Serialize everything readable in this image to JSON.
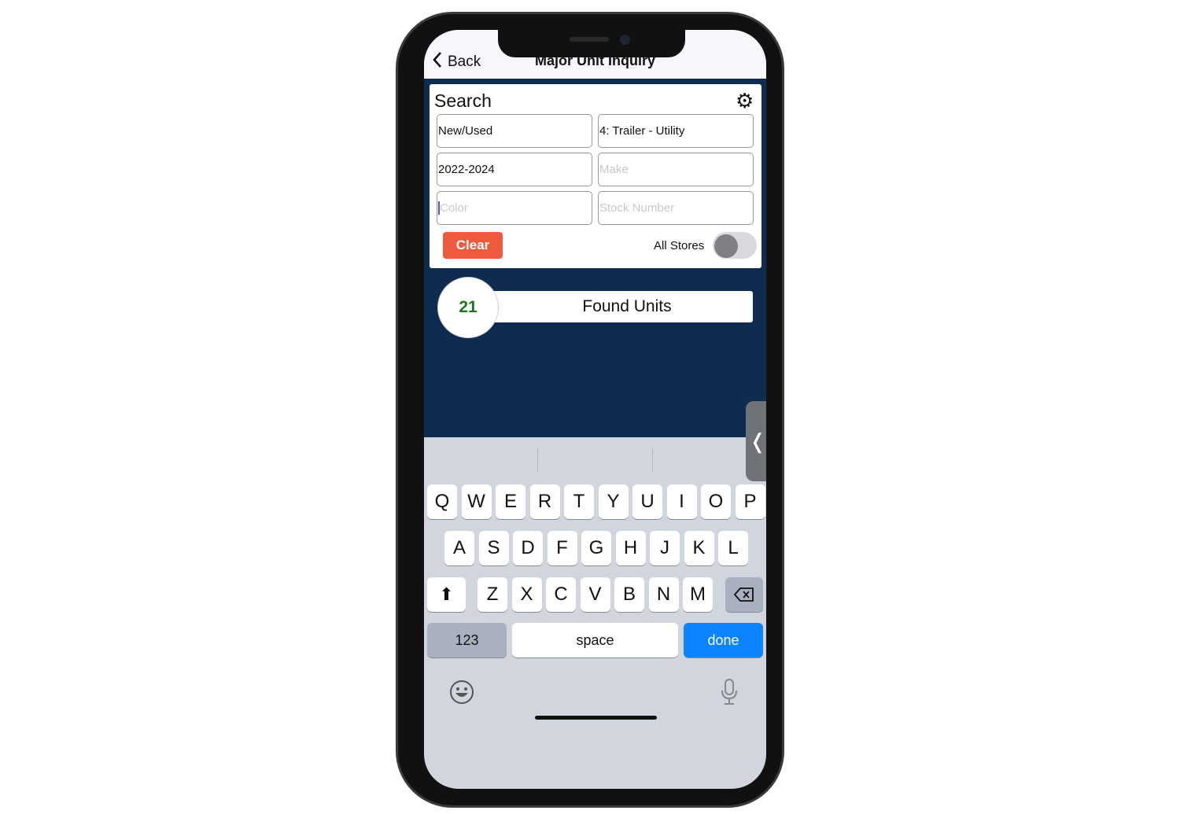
{
  "nav": {
    "back_label": "Back",
    "title": "Major Unit Inquiry"
  },
  "search": {
    "heading": "Search",
    "fields": {
      "new_used": {
        "value": "New/Used"
      },
      "category": {
        "value": "4: Trailer - Utility"
      },
      "years": {
        "value": "2022-2024"
      },
      "make": {
        "placeholder": "Make"
      },
      "color": {
        "placeholder": "Color"
      },
      "stock": {
        "placeholder": "Stock Number"
      }
    },
    "clear_label": "Clear",
    "all_stores_label": "All Stores",
    "all_stores_on": false
  },
  "results": {
    "count": "21",
    "label": "Found Units"
  },
  "colors": {
    "navy": "#0d2c4f",
    "clear": "#f05a3c",
    "count": "#147a1c",
    "done": "#0a84ff"
  },
  "keyboard": {
    "rows": [
      [
        "Q",
        "W",
        "E",
        "R",
        "T",
        "Y",
        "U",
        "I",
        "O",
        "P"
      ],
      [
        "A",
        "S",
        "D",
        "F",
        "G",
        "H",
        "J",
        "K",
        "L"
      ],
      [
        "Z",
        "X",
        "C",
        "V",
        "B",
        "N",
        "M"
      ]
    ],
    "numbers_label": "123",
    "space_label": "space",
    "done_label": "done"
  }
}
